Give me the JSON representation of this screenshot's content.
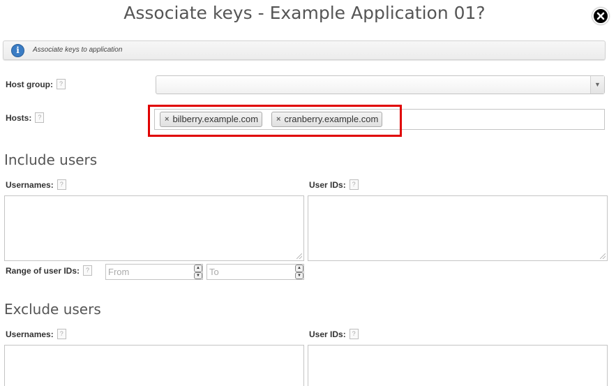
{
  "dialog": {
    "title": "Associate keys - Example Application 01?",
    "close_icon": "close-icon"
  },
  "info": {
    "icon": "info-icon",
    "glyph": "i",
    "text": "Associate keys to application"
  },
  "help_glyph": "?",
  "host_group": {
    "label": "Host group:",
    "value": "",
    "arrow": "▼"
  },
  "hosts": {
    "label": "Hosts:",
    "remove_glyph": "×",
    "tags": [
      "bilberry.example.com",
      "cranberry.example.com"
    ]
  },
  "include": {
    "title": "Include users",
    "usernames_label": "Usernames:",
    "userids_label": "User IDs:",
    "range_label": "Range of user IDs:",
    "from_placeholder": "From",
    "to_placeholder": "To"
  },
  "exclude": {
    "title": "Exclude users",
    "usernames_label": "Usernames:",
    "userids_label": "User IDs:"
  },
  "colors": {
    "highlight": "#e00000",
    "info_icon": "#3a7cc4"
  }
}
